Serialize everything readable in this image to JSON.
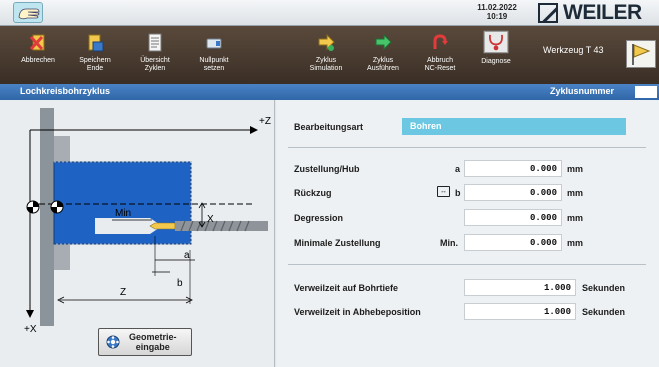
{
  "header": {
    "date": "11.02.2022",
    "time": "10:19",
    "logo_text": "WEILER"
  },
  "toolbar": {
    "buttons": [
      {
        "id": "cancel",
        "label": "Abbrechen",
        "icon": "cancel-icon"
      },
      {
        "id": "save-end",
        "label": "Speichern\nEnde",
        "icon": "save-icon"
      },
      {
        "id": "overview",
        "label": "Übersicht\nZyklen",
        "icon": "overview-icon"
      },
      {
        "id": "zero",
        "label": "Nullpunkt\nsetzen",
        "icon": "zero-point-icon"
      },
      {
        "id": "simulate",
        "label": "Zyklus\nSimulation",
        "icon": "simulate-icon"
      },
      {
        "id": "execute",
        "label": "Zyklus\nAusführen",
        "icon": "execute-icon"
      },
      {
        "id": "abort-reset",
        "label": "Abbruch\nNC-Reset",
        "icon": "abort-reset-icon"
      },
      {
        "id": "diagnose",
        "label": "Diagnose",
        "icon": "diagnose-icon"
      }
    ],
    "tool_label": "Werkzeug  T 43"
  },
  "titlebar": {
    "title": "Lochkreisbohrzyklus",
    "cycle_number_label": "Zyklusnummer",
    "cycle_number_value": ""
  },
  "sketch": {
    "axis_z": "+Z",
    "axis_x": "+X",
    "label_x": "X",
    "label_min": "Min",
    "label_a": "a",
    "label_b": "b",
    "label_z": "Z"
  },
  "geometry_button": {
    "label": "Geometrie-\neingabe",
    "icon": "gear-icon"
  },
  "form": {
    "mode": {
      "label": "Bearbeitungsart",
      "value": "Bohren"
    },
    "infeed": {
      "label": "Zustellung/Hub",
      "sym": "a",
      "value": "0.000",
      "unit": "mm"
    },
    "retract": {
      "label": "Rückzug",
      "sym": "b",
      "value": "0.000",
      "unit": "mm",
      "icon_text": "↔"
    },
    "degression": {
      "label": "Degression",
      "value": "0.000",
      "unit": "mm"
    },
    "min_infeed": {
      "label": "Minimale Zustellung",
      "sym": "Min.",
      "value": "0.000",
      "unit": "mm"
    },
    "dwell_depth": {
      "label": "Verweilzeit auf Bohrtiefe",
      "value": "1.000",
      "unit": "Sekunden"
    },
    "dwell_lift": {
      "label": "Verweilzeit in Abhebeposition",
      "value": "1.000",
      "unit": "Sekunden"
    }
  },
  "colors": {
    "toolbar_bg": "#3a2e25",
    "titlebar_bg": "#2f66a8",
    "workpiece_blue": "#1e63c4",
    "mode_field": "#6cc8e2"
  }
}
